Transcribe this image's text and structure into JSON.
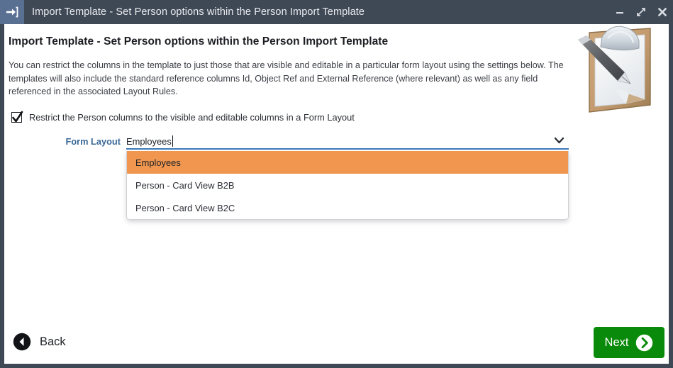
{
  "window": {
    "title": "Import Template - Set Person options within the Person Import Template",
    "app_icon": "import-arrow-icon",
    "controls": {
      "minimize": "minimize-icon",
      "maximize": "maximize-icon",
      "close": "close-icon"
    },
    "titlebar_color": "#3f4855"
  },
  "page": {
    "heading": "Import Template - Set Person options within the Person Import Template",
    "intro": "You can restrict the columns in the template to just those that are visible and editable in a particular form layout using the settings below. The templates will also include the standard reference columns Id, Object Ref and External Reference (where relevant) as well as any field referenced in the associated Layout Rules.",
    "illustration": "clipboard-with-pen-icon"
  },
  "restrict_option": {
    "checked": true,
    "label": "Restrict the Person columns to the visible and editable columns in a Form Layout",
    "checkbox_icon": "checkmark-icon"
  },
  "form_layout": {
    "label": "Form Layout",
    "value": "Employees",
    "placeholder": "",
    "arrow_icon": "chevron-down-icon",
    "expanded": true,
    "options": [
      {
        "label": "Employees",
        "selected": true
      },
      {
        "label": "Person - Card View B2B",
        "selected": false
      },
      {
        "label": "Person - Card View B2C",
        "selected": false
      }
    ]
  },
  "footer": {
    "back_label": "Back",
    "back_icon": "circle-chevron-left-icon",
    "next_label": "Next",
    "next_icon": "circle-chevron-right-icon"
  },
  "colors": {
    "titlebar": "#3f4855",
    "accent_label": "#3c6997",
    "highlight": "#f0964e",
    "next_button": "#0a8a0a",
    "field_underline": "#3d7ab8"
  }
}
